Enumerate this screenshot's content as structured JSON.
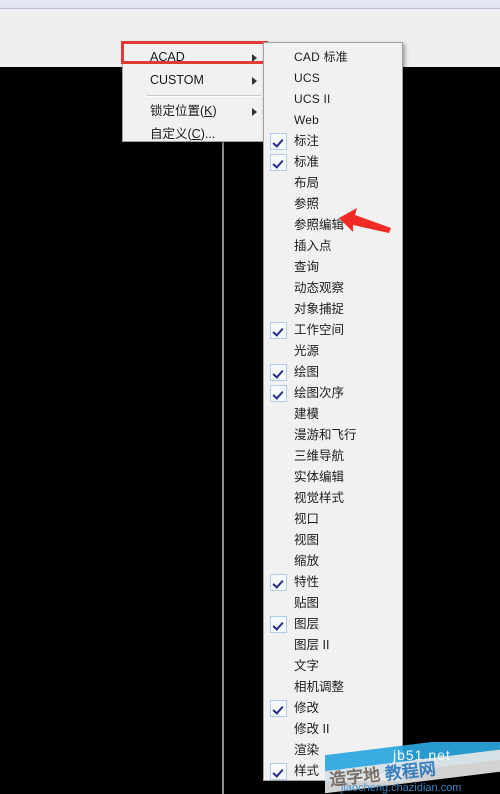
{
  "window": {
    "canvas_background": "#000000",
    "chrome_background": "#efefef",
    "accent_red": "#e23b35",
    "checkbox_border": "#b3ccec",
    "check_color": "#2a2a8c"
  },
  "parent_menu": {
    "name": "toolbar-group-menu",
    "items": [
      {
        "label": "ACAD",
        "submenu": true,
        "separator_after": false,
        "highlighted": true
      },
      {
        "label": "CUSTOM",
        "submenu": true,
        "separator_after": true,
        "highlighted": false
      },
      {
        "label": "锁定位置(K)",
        "submenu": true,
        "separator_after": false,
        "highlighted": false
      },
      {
        "label": "自定义(C)...",
        "submenu": false,
        "separator_after": false,
        "highlighted": false
      }
    ]
  },
  "child_menu": {
    "name": "acad-toolbar-list",
    "items": [
      {
        "label": "CAD 标准",
        "checked": false,
        "latin": true
      },
      {
        "label": "UCS",
        "checked": false,
        "latin": true
      },
      {
        "label": "UCS II",
        "checked": false,
        "latin": true
      },
      {
        "label": "Web",
        "checked": false,
        "latin": true
      },
      {
        "label": "标注",
        "checked": true,
        "latin": false
      },
      {
        "label": "标准",
        "checked": true,
        "latin": false
      },
      {
        "label": "布局",
        "checked": false,
        "latin": false
      },
      {
        "label": "参照",
        "checked": false,
        "latin": false
      },
      {
        "label": "参照编辑",
        "checked": false,
        "latin": false
      },
      {
        "label": "插入点",
        "checked": false,
        "latin": false
      },
      {
        "label": "查询",
        "checked": false,
        "latin": false
      },
      {
        "label": "动态观察",
        "checked": false,
        "latin": false
      },
      {
        "label": "对象捕捉",
        "checked": false,
        "latin": false
      },
      {
        "label": "工作空间",
        "checked": true,
        "latin": false
      },
      {
        "label": "光源",
        "checked": false,
        "latin": false
      },
      {
        "label": "绘图",
        "checked": true,
        "latin": false
      },
      {
        "label": "绘图次序",
        "checked": true,
        "latin": false
      },
      {
        "label": "建模",
        "checked": false,
        "latin": false
      },
      {
        "label": "漫游和飞行",
        "checked": false,
        "latin": false
      },
      {
        "label": "三维导航",
        "checked": false,
        "latin": false
      },
      {
        "label": "实体编辑",
        "checked": false,
        "latin": false
      },
      {
        "label": "视觉样式",
        "checked": false,
        "latin": false
      },
      {
        "label": "视口",
        "checked": false,
        "latin": false
      },
      {
        "label": "视图",
        "checked": false,
        "latin": false
      },
      {
        "label": "缩放",
        "checked": false,
        "latin": false
      },
      {
        "label": "特性",
        "checked": true,
        "latin": false
      },
      {
        "label": "贴图",
        "checked": false,
        "latin": false
      },
      {
        "label": "图层",
        "checked": true,
        "latin": false
      },
      {
        "label": "图层 II",
        "checked": false,
        "latin": false
      },
      {
        "label": "文字",
        "checked": false,
        "latin": false
      },
      {
        "label": "相机调整",
        "checked": false,
        "latin": false
      },
      {
        "label": "修改",
        "checked": true,
        "latin": false
      },
      {
        "label": "修改 II",
        "checked": false,
        "latin": false
      },
      {
        "label": "渲染",
        "checked": false,
        "latin": false
      },
      {
        "label": "样式",
        "checked": true,
        "latin": false
      }
    ]
  },
  "annotation": {
    "arrow_points_at": "参照编辑",
    "arrow_color": "#ee2b24"
  },
  "watermark": {
    "site": "jb51.net",
    "chinese": "造字地 教程网",
    "chinese_prefix": "造字地 ",
    "chinese_suffix": "教程网",
    "url": "jiaocheng.chazidian.com"
  }
}
